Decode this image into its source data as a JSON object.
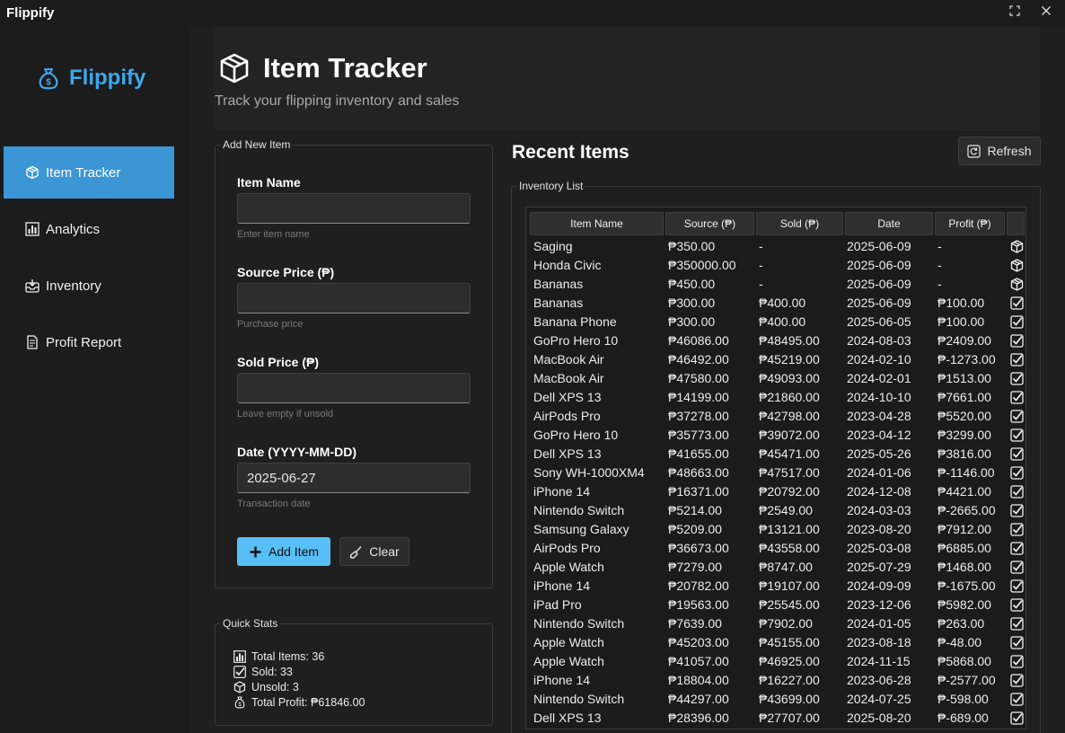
{
  "window": {
    "title": "Flippify"
  },
  "sidebar": {
    "brand": "Flippify",
    "items": [
      {
        "label": "Item Tracker",
        "icon": "package-icon",
        "active": true
      },
      {
        "label": "Analytics",
        "icon": "chart-icon",
        "active": false
      },
      {
        "label": "Inventory",
        "icon": "inbox-icon",
        "active": false
      },
      {
        "label": "Profit Report",
        "icon": "document-icon",
        "active": false
      }
    ]
  },
  "header": {
    "title": "Item Tracker",
    "subtitle": "Track your flipping inventory and sales"
  },
  "form": {
    "group_title": "Add New Item",
    "item_name": {
      "label": "Item Name",
      "value": "",
      "hint": "Enter item name"
    },
    "source_price": {
      "label": "Source Price (₱)",
      "value": "",
      "hint": "Purchase price"
    },
    "sold_price": {
      "label": "Sold Price (₱)",
      "value": "",
      "hint": "Leave empty if unsold"
    },
    "date": {
      "label": "Date (YYYY-MM-DD)",
      "value": "2025-06-27",
      "hint": "Transaction date"
    },
    "add_label": "Add Item",
    "clear_label": "Clear"
  },
  "stats": {
    "group_title": "Quick Stats",
    "total_items": "Total Items: 36",
    "sold": "Sold: 33",
    "unsold": "Unsold: 3",
    "total_profit": "Total Profit: ₱61846.00"
  },
  "recent": {
    "title": "Recent Items",
    "refresh_label": "Refresh",
    "list_title": "Inventory List",
    "columns": [
      "Item Name",
      "Source (₱)",
      "Sold (₱)",
      "Date",
      "Profit (₱)",
      ""
    ],
    "rows": [
      {
        "name": "Saging",
        "source": "₱350.00",
        "sold": "-",
        "date": "2025-06-09",
        "profit": "-",
        "status": "package-icon"
      },
      {
        "name": "Honda Civic",
        "source": "₱350000.00",
        "sold": "-",
        "date": "2025-06-09",
        "profit": "-",
        "status": "package-icon"
      },
      {
        "name": "Bananas",
        "source": "₱450.00",
        "sold": "-",
        "date": "2025-06-09",
        "profit": "-",
        "status": "package-icon"
      },
      {
        "name": "Bananas",
        "source": "₱300.00",
        "sold": "₱400.00",
        "date": "2025-06-09",
        "profit": "₱100.00",
        "status": "check-icon"
      },
      {
        "name": "Banana Phone",
        "source": "₱300.00",
        "sold": "₱400.00",
        "date": "2025-06-05",
        "profit": "₱100.00",
        "status": "check-icon"
      },
      {
        "name": "GoPro Hero 10",
        "source": "₱46086.00",
        "sold": "₱48495.00",
        "date": "2024-08-03",
        "profit": "₱2409.00",
        "status": "check-icon"
      },
      {
        "name": "MacBook Air",
        "source": "₱46492.00",
        "sold": "₱45219.00",
        "date": "2024-02-10",
        "profit": "₱-1273.00",
        "status": "check-icon"
      },
      {
        "name": "MacBook Air",
        "source": "₱47580.00",
        "sold": "₱49093.00",
        "date": "2024-02-01",
        "profit": "₱1513.00",
        "status": "check-icon"
      },
      {
        "name": "Dell XPS 13",
        "source": "₱14199.00",
        "sold": "₱21860.00",
        "date": "2024-10-10",
        "profit": "₱7661.00",
        "status": "check-icon"
      },
      {
        "name": "AirPods Pro",
        "source": "₱37278.00",
        "sold": "₱42798.00",
        "date": "2023-04-28",
        "profit": "₱5520.00",
        "status": "check-icon"
      },
      {
        "name": "GoPro Hero 10",
        "source": "₱35773.00",
        "sold": "₱39072.00",
        "date": "2023-04-12",
        "profit": "₱3299.00",
        "status": "check-icon"
      },
      {
        "name": "Dell XPS 13",
        "source": "₱41655.00",
        "sold": "₱45471.00",
        "date": "2025-05-26",
        "profit": "₱3816.00",
        "status": "check-icon"
      },
      {
        "name": "Sony WH-1000XM4",
        "source": "₱48663.00",
        "sold": "₱47517.00",
        "date": "2024-01-06",
        "profit": "₱-1146.00",
        "status": "check-icon"
      },
      {
        "name": "iPhone 14",
        "source": "₱16371.00",
        "sold": "₱20792.00",
        "date": "2024-12-08",
        "profit": "₱4421.00",
        "status": "check-icon"
      },
      {
        "name": "Nintendo Switch",
        "source": "₱5214.00",
        "sold": "₱2549.00",
        "date": "2024-03-03",
        "profit": "₱-2665.00",
        "status": "check-icon"
      },
      {
        "name": "Samsung Galaxy",
        "source": "₱5209.00",
        "sold": "₱13121.00",
        "date": "2023-08-20",
        "profit": "₱7912.00",
        "status": "check-icon"
      },
      {
        "name": "AirPods Pro",
        "source": "₱36673.00",
        "sold": "₱43558.00",
        "date": "2025-03-08",
        "profit": "₱6885.00",
        "status": "check-icon"
      },
      {
        "name": "Apple Watch",
        "source": "₱7279.00",
        "sold": "₱8747.00",
        "date": "2025-07-29",
        "profit": "₱1468.00",
        "status": "check-icon"
      },
      {
        "name": "iPhone 14",
        "source": "₱20782.00",
        "sold": "₱19107.00",
        "date": "2024-09-09",
        "profit": "₱-1675.00",
        "status": "check-icon"
      },
      {
        "name": "iPad Pro",
        "source": "₱19563.00",
        "sold": "₱25545.00",
        "date": "2023-12-06",
        "profit": "₱5982.00",
        "status": "check-icon"
      },
      {
        "name": "Nintendo Switch",
        "source": "₱7639.00",
        "sold": "₱7902.00",
        "date": "2024-01-05",
        "profit": "₱263.00",
        "status": "check-icon"
      },
      {
        "name": "Apple Watch",
        "source": "₱45203.00",
        "sold": "₱45155.00",
        "date": "2023-08-18",
        "profit": "₱-48.00",
        "status": "check-icon"
      },
      {
        "name": "Apple Watch",
        "source": "₱41057.00",
        "sold": "₱46925.00",
        "date": "2024-11-15",
        "profit": "₱5868.00",
        "status": "check-icon"
      },
      {
        "name": "iPhone 14",
        "source": "₱18804.00",
        "sold": "₱16227.00",
        "date": "2023-06-28",
        "profit": "₱-2577.00",
        "status": "check-icon"
      },
      {
        "name": "Nintendo Switch",
        "source": "₱44297.00",
        "sold": "₱43699.00",
        "date": "2024-07-25",
        "profit": "₱-598.00",
        "status": "check-icon"
      },
      {
        "name": "Dell XPS 13",
        "source": "₱28396.00",
        "sold": "₱27707.00",
        "date": "2025-08-20",
        "profit": "₱-689.00",
        "status": "check-icon"
      }
    ]
  },
  "colors": {
    "accent": "#3b96d6",
    "brand": "#3da8ec",
    "primary_button": "#57bff5"
  }
}
